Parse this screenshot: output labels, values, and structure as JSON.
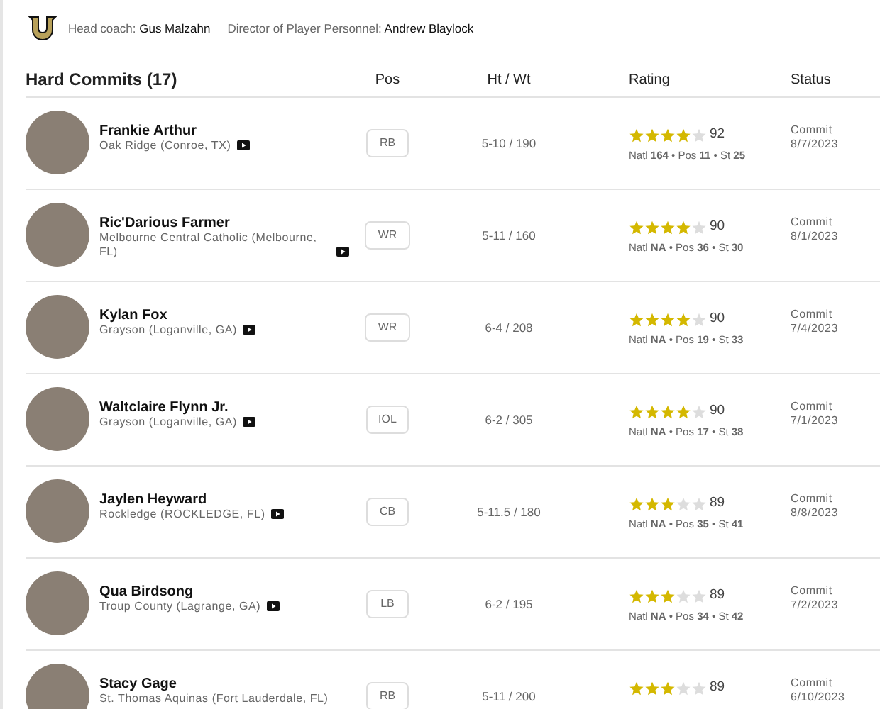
{
  "header": {
    "coach_label": "Head coach:",
    "coach_name": "Gus Malzahn",
    "director_label": "Director of Player Personnel:",
    "director_name": "Andrew Blaylock"
  },
  "table": {
    "title": "Hard Commits (17)",
    "columns": [
      "Pos",
      "Ht / Wt",
      "Rating",
      "Status"
    ],
    "rows": [
      {
        "name": "Frankie Arthur",
        "school": "Oak Ridge (Conroe, TX)",
        "has_video": true,
        "pos": "RB",
        "ht_wt": "5-10 / 190",
        "stars": 4,
        "score": "92",
        "ranks": "Natl **164** • Pos **11** • St **25**",
        "status": "Commit",
        "date": "8/7/2023"
      },
      {
        "name": "Ric'Darious Farmer",
        "school": "Melbourne Central Catholic (Melbourne, FL)",
        "has_video": true,
        "pos": "WR",
        "ht_wt": "5-11 / 160",
        "stars": 4,
        "score": "90",
        "ranks": "Natl **NA** • Pos **36** • St **30**",
        "status": "Commit",
        "date": "8/1/2023"
      },
      {
        "name": "Kylan Fox",
        "school": "Grayson (Loganville, GA)",
        "has_video": true,
        "pos": "WR",
        "ht_wt": "6-4 / 208",
        "stars": 4,
        "score": "90",
        "ranks": "Natl **NA** • Pos **19** • St **33**",
        "status": "Commit",
        "date": "7/4/2023"
      },
      {
        "name": "Waltclaire Flynn Jr.",
        "school": "Grayson (Loganville, GA)",
        "has_video": true,
        "pos": "IOL",
        "ht_wt": "6-2 / 305",
        "stars": 4,
        "score": "90",
        "ranks": "Natl **NA** • Pos **17** • St **38**",
        "status": "Commit",
        "date": "7/1/2023"
      },
      {
        "name": "Jaylen Heyward",
        "school": "Rockledge (ROCKLEDGE, FL)",
        "has_video": true,
        "pos": "CB",
        "ht_wt": "5-11.5 / 180",
        "stars": 3,
        "score": "89",
        "ranks": "Natl **NA** • Pos **35** • St **41**",
        "status": "Commit",
        "date": "8/8/2023"
      },
      {
        "name": "Qua Birdsong",
        "school": "Troup County (Lagrange, GA)",
        "has_video": true,
        "pos": "LB",
        "ht_wt": "6-2 / 195",
        "stars": 3,
        "score": "89",
        "ranks": "Natl **NA** • Pos **34** • St **42**",
        "status": "Commit",
        "date": "7/2/2023"
      },
      {
        "name": "Stacy Gage",
        "school": "St. Thomas Aquinas (Fort Lauderdale, FL)",
        "has_video": false,
        "pos": "RB",
        "ht_wt": "5-11 / 200",
        "stars": 3,
        "score": "89",
        "status": "Commit",
        "date": "6/10/2023"
      }
    ]
  }
}
